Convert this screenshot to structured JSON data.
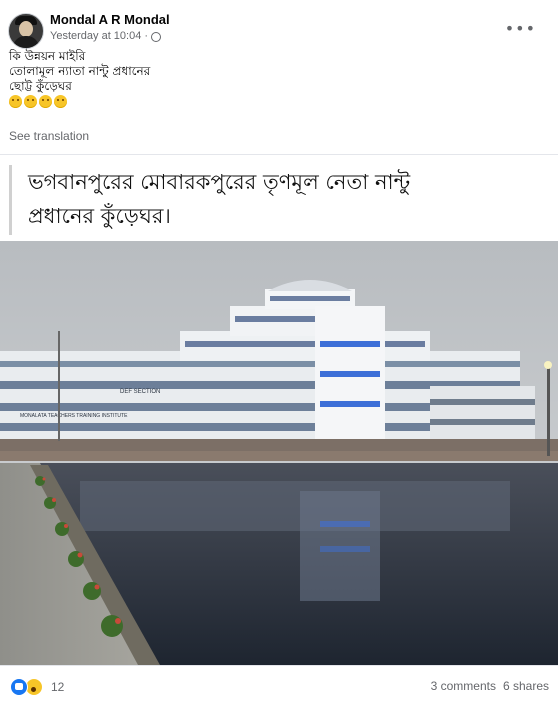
{
  "post": {
    "author": "Mondal A R Mondal",
    "timestamp": "Yesterday at 10:04",
    "separator": "·",
    "privacy_icon": "globe-icon",
    "more_icon": "more-options-icon",
    "text_lines": [
      "কি উন্নয়ন মাইরি",
      "তোলামূল ন্যাতা নান্টু প্রধানের",
      "ছোট্ট কুঁড়েঘর"
    ],
    "emoji_count": 4,
    "see_translation": "See translation"
  },
  "shared_image": {
    "caption_line1": "ভগবানপুরের মোবারকপুরের তৃণমূল নেতা নান্টু",
    "caption_line2": "প্রধানের কুঁড়েঘর।",
    "building_signs": [
      "DEF SECTION",
      "MONALATA TEACHERS TRAINING INSTITUTE"
    ]
  },
  "footer": {
    "reaction_icons": [
      "like-icon",
      "wow-icon"
    ],
    "reaction_count": "12",
    "comments": "3 comments",
    "shares": "6 shares"
  }
}
